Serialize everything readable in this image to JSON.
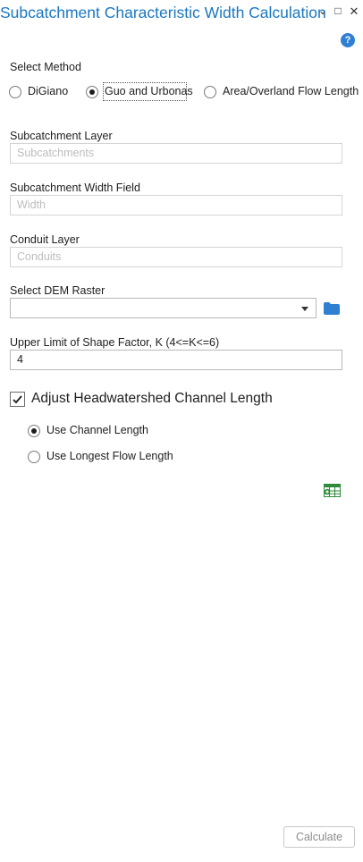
{
  "header": {
    "title": "Subcatchment Characteristic Width Calculation",
    "menu_glyph": "⌄",
    "maximize_glyph": "□",
    "close_glyph": "✕",
    "help_glyph": "?"
  },
  "method": {
    "label": "Select Method",
    "options": [
      "DiGiano",
      "Guo and Urbonas",
      "Area/Overland Flow Length"
    ],
    "selected": "Guo and Urbonas"
  },
  "subcatchment_layer": {
    "label": "Subcatchment Layer",
    "placeholder": "Subcatchments"
  },
  "width_field": {
    "label": "Subcatchment Width Field",
    "placeholder": "Width"
  },
  "conduit_layer": {
    "label": "Conduit Layer",
    "placeholder": "Conduits"
  },
  "dem": {
    "label": "Select DEM Raster",
    "value": ""
  },
  "shape_factor": {
    "label": "Upper Limit of Shape Factor, K (4<=K<=6)",
    "value": "4"
  },
  "adjust": {
    "label": "Adjust Headwatershed Channel Length",
    "checked": true,
    "options": [
      "Use Channel Length",
      "Use Longest Flow Length"
    ],
    "selected": "Use Channel Length"
  },
  "actions": {
    "calculate_label": "Calculate"
  },
  "colors": {
    "title": "#1a78c2",
    "help": "#2f7fd3",
    "folder": "#2f7fd3",
    "table_icon": "#2e8b3a"
  },
  "icons": {
    "help": "help-icon",
    "folder": "folder-icon",
    "table": "table-icon"
  }
}
